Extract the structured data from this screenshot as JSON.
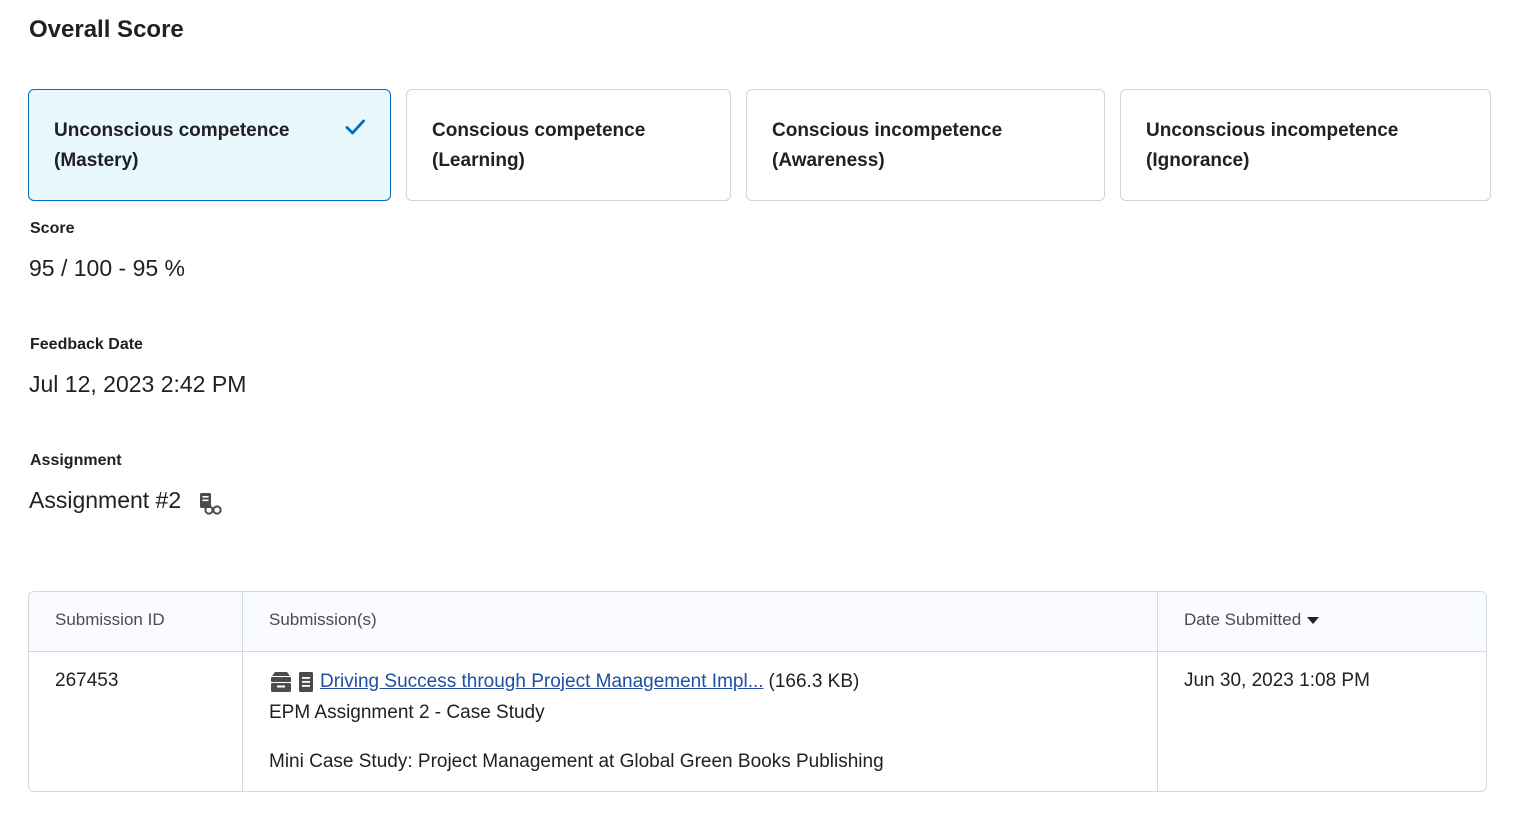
{
  "heading": "Overall Score",
  "levels": [
    {
      "line1": "Unconscious competence",
      "line2": "(Mastery)",
      "selected": true
    },
    {
      "line1": "Conscious competence",
      "line2": "(Learning)",
      "selected": false
    },
    {
      "line1": "Conscious incompetence",
      "line2": "(Awareness)",
      "selected": false
    },
    {
      "line1": "Unconscious incompetence",
      "line2": "(Ignorance)",
      "selected": false
    }
  ],
  "score": {
    "label": "Score",
    "value": "95 / 100 - 95 %"
  },
  "feedback_date": {
    "label": "Feedback Date",
    "value": "Jul 12, 2023 2:42 PM"
  },
  "assignment": {
    "label": "Assignment",
    "value": "Assignment #2",
    "icon": "assignment-copy-icon"
  },
  "table": {
    "headers": {
      "id": "Submission ID",
      "submissions": "Submission(s)",
      "date": "Date Submitted"
    },
    "rows": [
      {
        "id": "267453",
        "file_link": "Driving Success through Project Management Impl...",
        "file_size": "(166.3 KB)",
        "title": "EPM Assignment 2 - Case Study",
        "comment": "Mini Case Study: Project Management at Global Green Books Publishing",
        "date": "Jun 30, 2023 1:08 PM"
      }
    ]
  },
  "colors": {
    "accent": "#006fbf",
    "selected_bg": "#e8f8fd",
    "border": "#cdd5dc",
    "link": "#1e4fa3"
  }
}
